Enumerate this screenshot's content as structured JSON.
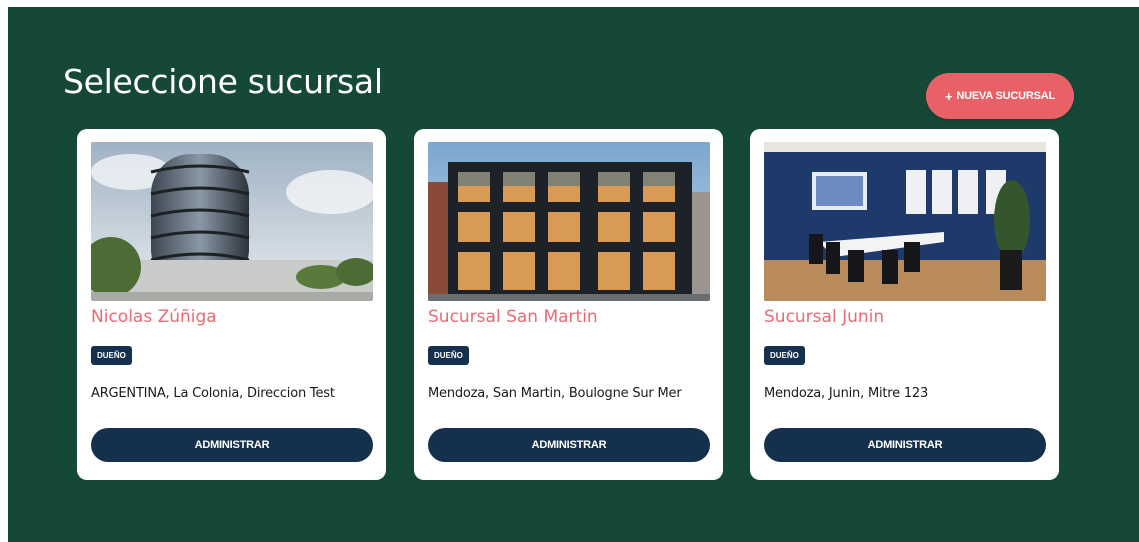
{
  "page": {
    "title": "Seleccione sucursal"
  },
  "actions": {
    "new_branch_icon": "plus-icon",
    "new_branch_label": "NUEVA SUCURSAL"
  },
  "colors": {
    "background": "#164838",
    "accent": "#e86166",
    "primary": "#15304d",
    "card": "#ffffff"
  },
  "branches": [
    {
      "name": "Nicolas Zúñiga",
      "badge": "DUEÑO",
      "address": "ARGENTINA, La Colonia, Direccion Test",
      "button": "ADMINISTRAR",
      "image": "modern-round-glass-building-photo"
    },
    {
      "name": "Sucursal San Martin",
      "badge": "DUEÑO",
      "address": "Mendoza, San Martin, Boulogne Sur Mer",
      "button": "ADMINISTRAR",
      "image": "glass-office-facade-photo"
    },
    {
      "name": "Sucursal Junin",
      "badge": "DUEÑO",
      "address": "Mendoza, Junin, Mitre 123",
      "button": "ADMINISTRAR",
      "image": "meeting-room-photo"
    }
  ]
}
